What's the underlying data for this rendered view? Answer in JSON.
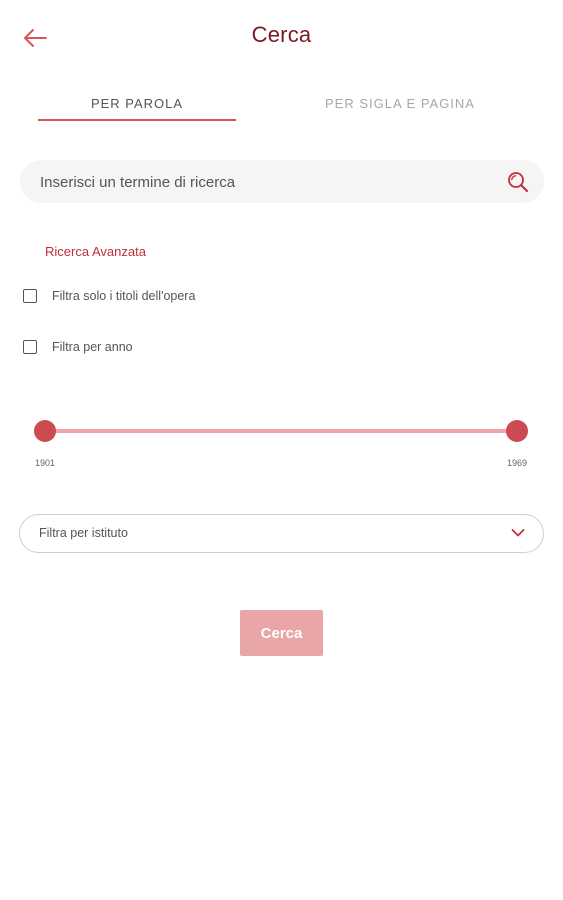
{
  "header": {
    "title": "Cerca",
    "back_icon": "arrow-left-icon"
  },
  "tabs": [
    {
      "label": "PER PAROLA",
      "active": true
    },
    {
      "label": "PER SIGLA E PAGINA",
      "active": false
    }
  ],
  "search": {
    "placeholder": "Inserisci un termine di ricerca",
    "value": "",
    "icon": "search-icon"
  },
  "advanced": {
    "label": "Ricerca Avanzata",
    "filters": [
      {
        "label": "Filtra solo i titoli dell'opera",
        "checked": false
      },
      {
        "label": "Filtra per anno",
        "checked": false
      }
    ],
    "year_range": {
      "min_label": "1901",
      "max_label": "1969"
    },
    "institute_dropdown": {
      "label": "Filtra per istituto",
      "icon": "chevron-down-icon"
    }
  },
  "submit": {
    "label": "Cerca"
  },
  "colors": {
    "accent": "#d9545a",
    "title": "#7a1a22",
    "thumb": "#cc4a52",
    "track": "#f2a4a8",
    "button": "#e8a6a8",
    "advanced_label": "#c0303a"
  }
}
